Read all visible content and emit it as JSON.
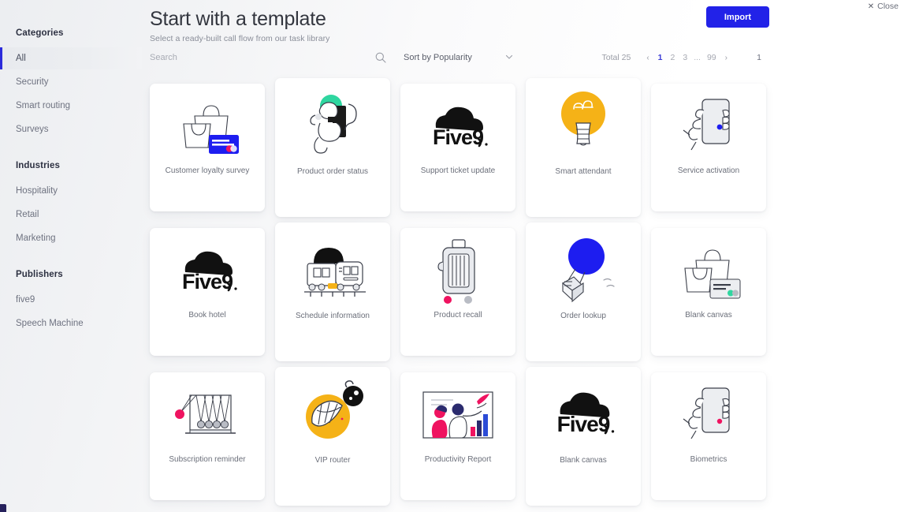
{
  "header": {
    "title": "Start with a template",
    "subtitle": "Select a ready-built call flow from our task library",
    "import_label": "Import",
    "close_label": "Close",
    "close_icon": "close-x-icon"
  },
  "sidebar": {
    "groups": [
      {
        "title": "Categories",
        "items": [
          {
            "label": "All",
            "active": true
          },
          {
            "label": "Security",
            "active": false
          },
          {
            "label": "Smart routing",
            "active": false
          },
          {
            "label": "Surveys",
            "active": false
          }
        ]
      },
      {
        "title": "Industries",
        "items": [
          {
            "label": "Hospitality",
            "active": false
          },
          {
            "label": "Retail",
            "active": false
          },
          {
            "label": "Marketing",
            "active": false
          }
        ]
      },
      {
        "title": "Publishers",
        "items": [
          {
            "label": "five9",
            "active": false
          },
          {
            "label": "Speech Machine",
            "active": false
          }
        ]
      }
    ]
  },
  "toolbar": {
    "search_placeholder": "Search",
    "search_value": "",
    "search_icon": "search-icon",
    "sort_label": "Sort by Popularity",
    "sort_caret_icon": "chevron-down-icon"
  },
  "pagination": {
    "total_label": "Total 25",
    "prev_icon": "chevron-left-icon",
    "next_icon": "chevron-right-icon",
    "pages": [
      "1",
      "2",
      "3"
    ],
    "ellipsis": "...",
    "last_page": "99",
    "current_page": "1",
    "jump_value": "1"
  },
  "colors": {
    "accent_blue": "#2222e8",
    "active_page_blue": "#3b3bd6",
    "yellow": "#f5b217",
    "green": "#2fd6a0",
    "pink": "#ef1360",
    "sidebar_accent": "#2b2bdb"
  },
  "cards": [
    {
      "label": "Customer loyalty survey",
      "art": "shopping-bag-card-illustration"
    },
    {
      "label": "Product order status",
      "art": "astronaut-illustration"
    },
    {
      "label": "Support ticket update",
      "art": "five9-logo"
    },
    {
      "label": "Smart attendant",
      "art": "lightbulb-illustration"
    },
    {
      "label": "Service activation",
      "art": "hand-phone-illustration"
    },
    {
      "label": "Book hotel",
      "art": "five9-logo"
    },
    {
      "label": "Schedule information",
      "art": "train-illustration"
    },
    {
      "label": "Product recall",
      "art": "suitcase-illustration"
    },
    {
      "label": "Order lookup",
      "art": "hot-air-balloon-illustration"
    },
    {
      "label": "Blank canvas",
      "art": "shopping-bag-card-illustration"
    },
    {
      "label": "Subscription reminder",
      "art": "newtons-cradle-illustration"
    },
    {
      "label": "VIP router",
      "art": "croissant-coffee-illustration"
    },
    {
      "label": "Productivity Report",
      "art": "presentation-chart-illustration"
    },
    {
      "label": "Blank canvas",
      "art": "five9-logo"
    },
    {
      "label": "Biometrics",
      "art": "hand-phone-illustration"
    }
  ]
}
